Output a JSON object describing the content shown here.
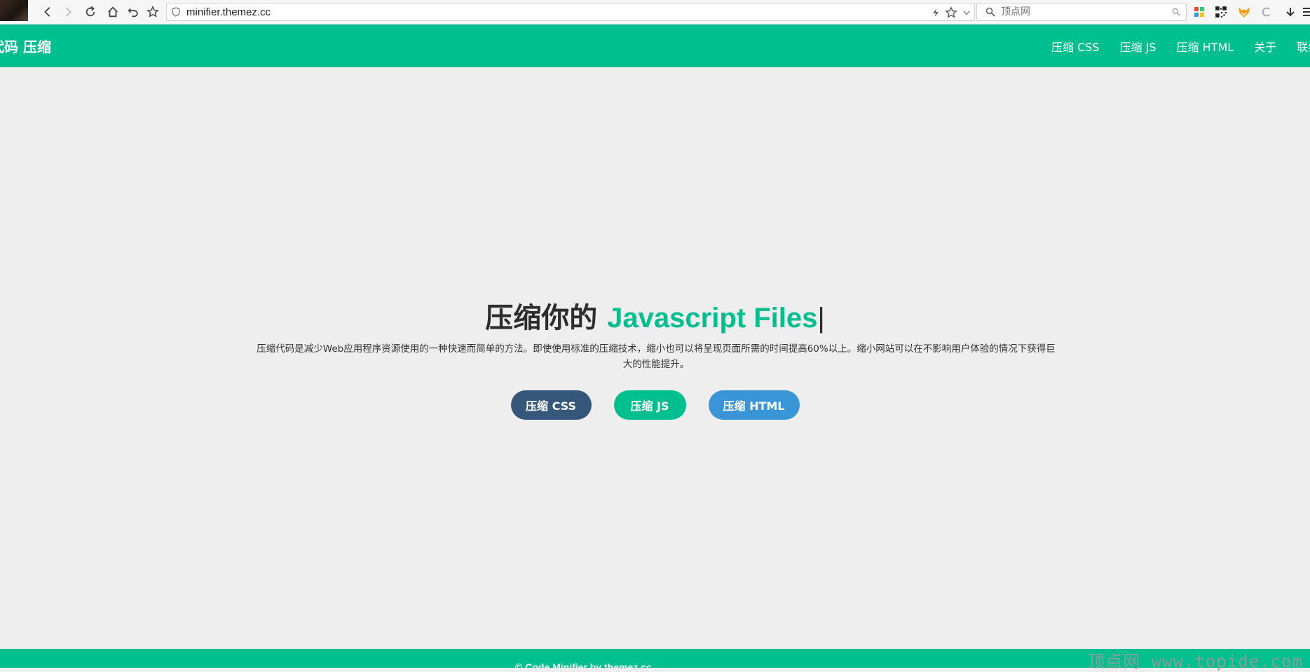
{
  "browser": {
    "url": "minifier.themez.cc",
    "search_placeholder": "顶点网"
  },
  "header": {
    "brand": "代码 压缩",
    "nav": [
      {
        "label": "压缩 CSS"
      },
      {
        "label": "压缩 JS"
      },
      {
        "label": "压缩 HTML"
      },
      {
        "label": "关于"
      },
      {
        "label": "联络"
      }
    ]
  },
  "hero": {
    "title_lead": "压缩你的 ",
    "title_accent": "Javascript Files",
    "caret": "|",
    "description": "压缩代码是减少Web应用程序资源使用的一种快速而简单的方法。即使使用标准的压缩技术，缩小也可以将呈现页面所需的时间提高60%以上。缩小网站可以在不影响用户体验的情况下获得巨大的性能提升。",
    "buttons": {
      "css": "压缩 CSS",
      "js": "压缩 JS",
      "html": "压缩 HTML"
    }
  },
  "footer": {
    "text": "© Code Minifier by themez.cc"
  },
  "watermark": "顶点网 www.topide.com",
  "colors": {
    "brand_green": "#00bf8f",
    "btn_css": "#34577a",
    "btn_html": "#3a95d6",
    "page_bg": "#eeeeee"
  },
  "icons": {
    "back": "arrow-left-icon",
    "forward": "arrow-right-icon",
    "reload": "reload-icon",
    "home": "home-icon",
    "undo": "undo-icon",
    "bookmark": "star-icon",
    "shield": "shield-icon",
    "lightning": "lightning-icon",
    "search": "search-icon"
  }
}
